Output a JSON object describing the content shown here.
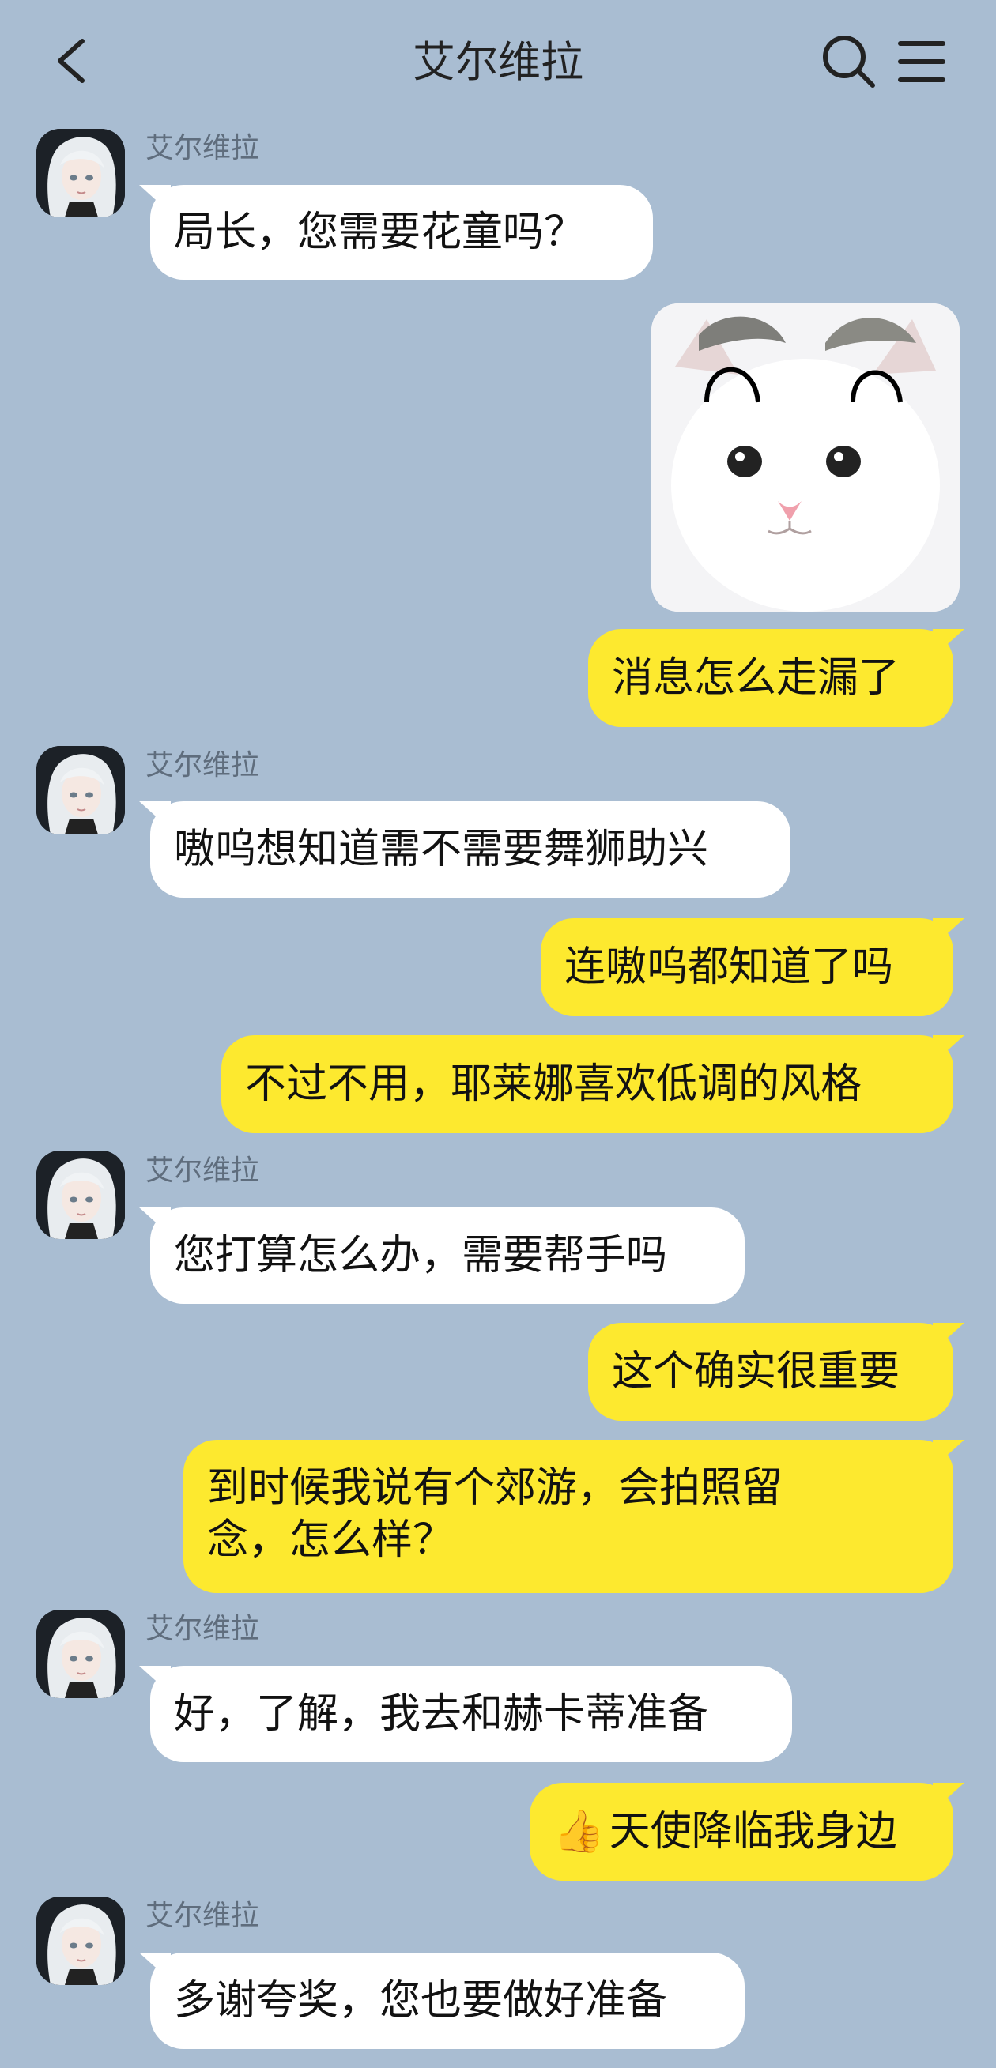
{
  "header": {
    "title": "艾尔维拉",
    "back_icon": "chevron-left-icon",
    "search_icon": "search-icon",
    "menu_icon": "menu-icon"
  },
  "colors": {
    "background": "#a9bdd2",
    "incoming_bubble": "#ffffff",
    "outgoing_bubble": "#fde92f"
  },
  "messages": [
    {
      "side": "left",
      "sender": "艾尔维拉",
      "text": "局长，您需要花童吗？"
    },
    {
      "side": "right",
      "type": "sticker",
      "sticker": "cat-sticker"
    },
    {
      "side": "right",
      "text": "消息怎么走漏了"
    },
    {
      "side": "left",
      "sender": "艾尔维拉",
      "text": "嗷呜想知道需不需要舞狮助兴"
    },
    {
      "side": "right",
      "text": "连嗷呜都知道了吗"
    },
    {
      "side": "right",
      "text": "不过不用，耶莱娜喜欢低调的风格"
    },
    {
      "side": "left",
      "sender": "艾尔维拉",
      "text": "您打算怎么办，需要帮手吗"
    },
    {
      "side": "right",
      "text": "这个确实很重要"
    },
    {
      "side": "right",
      "text": "到时候我说有个郊游，会拍照留念，怎么样？"
    },
    {
      "side": "left",
      "sender": "艾尔维拉",
      "text": "好，了解，我去和赫卡蒂准备"
    },
    {
      "side": "right",
      "emoji": "👍",
      "text": "天使降临我身边"
    },
    {
      "side": "left",
      "sender": "艾尔维拉",
      "text": "多谢夸奖，您也要做好准备"
    }
  ]
}
